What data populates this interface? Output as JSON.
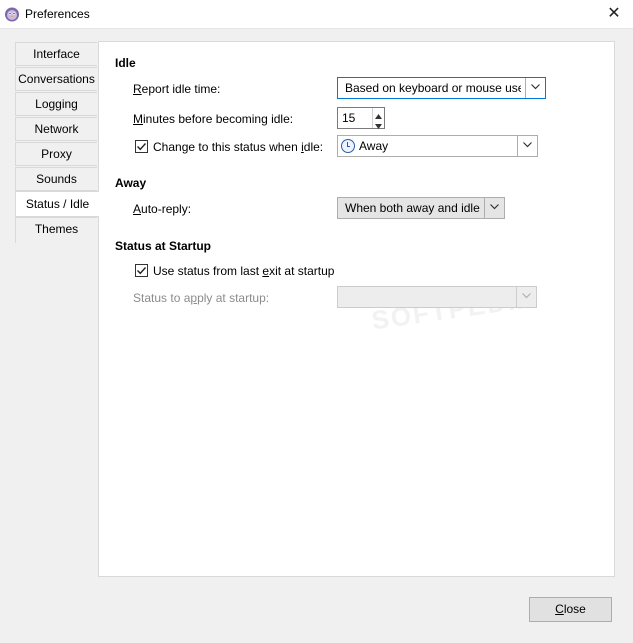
{
  "window": {
    "title": "Preferences",
    "close_glyph": "✕",
    "icon": "pidgin-app-icon"
  },
  "tabs": [
    {
      "label": "Interface"
    },
    {
      "label": "Conversations"
    },
    {
      "label": "Logging"
    },
    {
      "label": "Network"
    },
    {
      "label": "Proxy"
    },
    {
      "label": "Sounds"
    },
    {
      "label": "Status / Idle",
      "active": true
    },
    {
      "label": "Themes"
    }
  ],
  "idle": {
    "heading": "Idle",
    "report_label_prefix": "R",
    "report_label_rest": "eport idle time:",
    "report_value": "Based on keyboard or mouse use",
    "minutes_label_prefix": "M",
    "minutes_label_rest": "inutes before becoming idle:",
    "minutes_value": "15",
    "change_label_start": "Change to this status when ",
    "change_label_u": "i",
    "change_label_end": "dle:",
    "change_checked": true,
    "status_value": "Away",
    "status_icon": "away-clock-icon"
  },
  "away": {
    "heading": "Away",
    "autoreply_label_prefix": "A",
    "autoreply_label_rest": "uto-reply:",
    "autoreply_value": "When both away and idle"
  },
  "startup": {
    "heading": "Status at Startup",
    "use_label_start": "Use status from last ",
    "use_label_u": "e",
    "use_label_end": "xit at startup",
    "use_checked": true,
    "apply_label_start": "Status to a",
    "apply_label_u": "p",
    "apply_label_end": "ply at startup:",
    "apply_value": ""
  },
  "footer": {
    "close_label_u": "C",
    "close_label_rest": "lose"
  },
  "colors": {
    "focus": "#0078d7",
    "disabled_text": "#8c8c8c"
  }
}
